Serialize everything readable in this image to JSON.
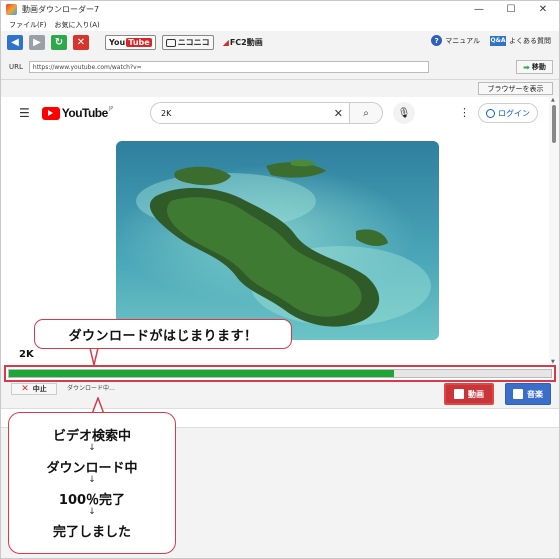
{
  "window": {
    "title": "動画ダウンローダー7",
    "minimize": "—",
    "maximize": "☐",
    "close": "✕"
  },
  "menu": {
    "items": [
      "ファイル(F)",
      "お気に入り(A)"
    ]
  },
  "toolbar": {
    "youtube_you": "You",
    "youtube_tube": "Tube",
    "niconico": "ニコニコ",
    "fc2": "FC2動画",
    "manual": "マニュアル",
    "faq": "よくある質問",
    "faq_badge": "Q&A"
  },
  "url": {
    "label": "URL",
    "value": "https://www.youtube.com/watch?v=",
    "go": "移動"
  },
  "browser_button": "ブラウザーを表示",
  "youtube": {
    "logo": "YouTube",
    "region": "JP",
    "search_value": "2K",
    "login": "ログイン",
    "video_title": "2K"
  },
  "progress": {
    "value": 0.71
  },
  "status": {
    "cancel": "中止",
    "text": "ダウンロード中…",
    "video_button": "動画",
    "audio_button": "音楽"
  },
  "callouts": {
    "top": "ダウンロードがはじまります！",
    "steps": [
      "ビデオ検索中",
      "ダウンロード中",
      "100％完了",
      "完了しました"
    ]
  },
  "colors": {
    "accent_red": "#d93a4a",
    "progress_green": "#1da635",
    "youtube_red": "#ff0000"
  }
}
